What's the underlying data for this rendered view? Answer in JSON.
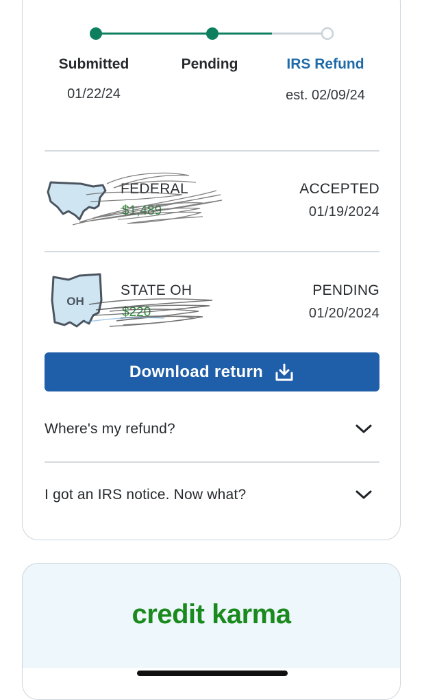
{
  "timeline": {
    "steps": [
      {
        "label": "Submitted",
        "date": "01/22/24"
      },
      {
        "label": "Pending",
        "date": ""
      },
      {
        "label": "IRS Refund",
        "date": "est. 02/09/24"
      }
    ],
    "progress": 0.67,
    "colors": {
      "done": "#0d7f5f",
      "pending": "#c9d3da",
      "accent": "#1f6aa8"
    }
  },
  "returns": [
    {
      "name": "FEDERAL",
      "amount": "$1,489",
      "status": "ACCEPTED",
      "date": "01/19/2024",
      "icon": "us-map-icon"
    },
    {
      "name": "STATE OH",
      "amount": "$220",
      "status": "PENDING",
      "date": "01/20/2024",
      "icon": "ohio-map-icon",
      "badge": "OH"
    }
  ],
  "download_button": {
    "label": "Download return",
    "icon": "download-icon"
  },
  "faq": [
    {
      "question": "Where's my refund?"
    },
    {
      "question": "I got an IRS notice. Now what?"
    }
  ],
  "promo": {
    "logo_text": "credit karma",
    "brand_color": "#1a8a1e"
  }
}
